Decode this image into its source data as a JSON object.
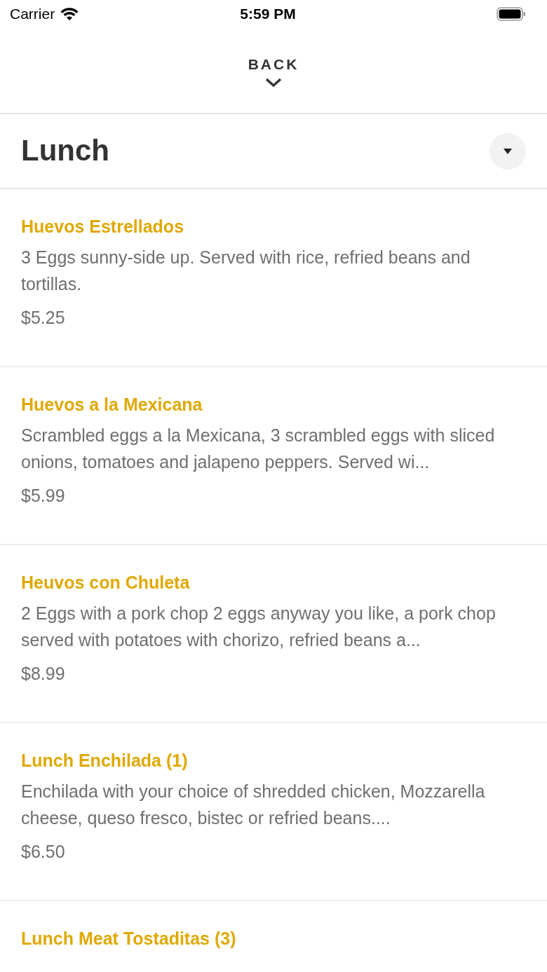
{
  "status_bar": {
    "carrier": "Carrier",
    "time": "5:59 PM"
  },
  "back": {
    "label": "BACK"
  },
  "section": {
    "title": "Lunch",
    "expanded": false
  },
  "items": [
    {
      "name": "Huevos Estrellados",
      "description": "3 Eggs sunny-side up. Served with rice, refried beans and tortillas.",
      "price": "$5.25"
    },
    {
      "name": "Huevos a la Mexicana",
      "description": "Scrambled eggs a la Mexicana, 3 scrambled eggs with sliced onions, tomatoes and jalapeno peppers. Served wi...",
      "price": "$5.99"
    },
    {
      "name": "Heuvos con Chuleta",
      "description": "2 Eggs with a pork chop 2 eggs anyway you like, a pork chop served with potatoes with chorizo, refried beans a...",
      "price": "$8.99"
    },
    {
      "name": "Lunch Enchilada (1)",
      "description": "Enchilada with your choice of shredded chicken, Mozzarella cheese, queso fresco, bistec or refried beans....",
      "price": "$6.50"
    },
    {
      "name": "Lunch Meat Tostaditas (3)"
    }
  ]
}
